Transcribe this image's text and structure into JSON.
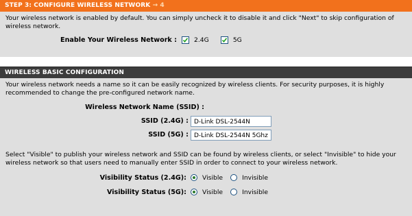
{
  "step3": {
    "title": "STEP 3: CONFIGURE WIRELESS NETWORK",
    "arrow": "→ 4",
    "description": "Your wireless network is enabled by default. You can simply uncheck it to disable it and click \"Next\" to skip configuration of wireless network.",
    "enable_label": "Enable Your Wireless Network :",
    "option_24": {
      "label": "2.4G",
      "checked": true
    },
    "option_5": {
      "label": "5G",
      "checked": true
    }
  },
  "basic": {
    "title": "WIRELESS BASIC CONFIGURATION",
    "description": "Your wireless network needs a name so it can be easily recognized by wireless clients. For security purposes, it is highly recommended to change the pre-configured network name.",
    "ssid_heading": "Wireless Network Name (SSID) :",
    "ssid_24_label": "SSID (2.4G) :",
    "ssid_24_value": "D-Link DSL-2544N",
    "ssid_5_label": "SSID (5G) :",
    "ssid_5_value": "D-Link DSL-2544N 5Ghz",
    "visibility_description": "Select \"Visible\" to publish your wireless network and SSID can be found by wireless clients, or select \"Invisible\" to hide your wireless network so that users need to manually enter SSID in order to connect to your wireless network.",
    "vis_24_label": "Visibility Status (2.4G):",
    "vis_5_label": "Visibility Status (5G):",
    "visible_label": "Visible",
    "invisible_label": "Invisible",
    "vis_24_selected": "Visible",
    "vis_5_selected": "Visible"
  },
  "colors": {
    "step_bar": "#f2711c",
    "section_bar": "#3c3c3c",
    "panel": "#dfdfdf"
  }
}
